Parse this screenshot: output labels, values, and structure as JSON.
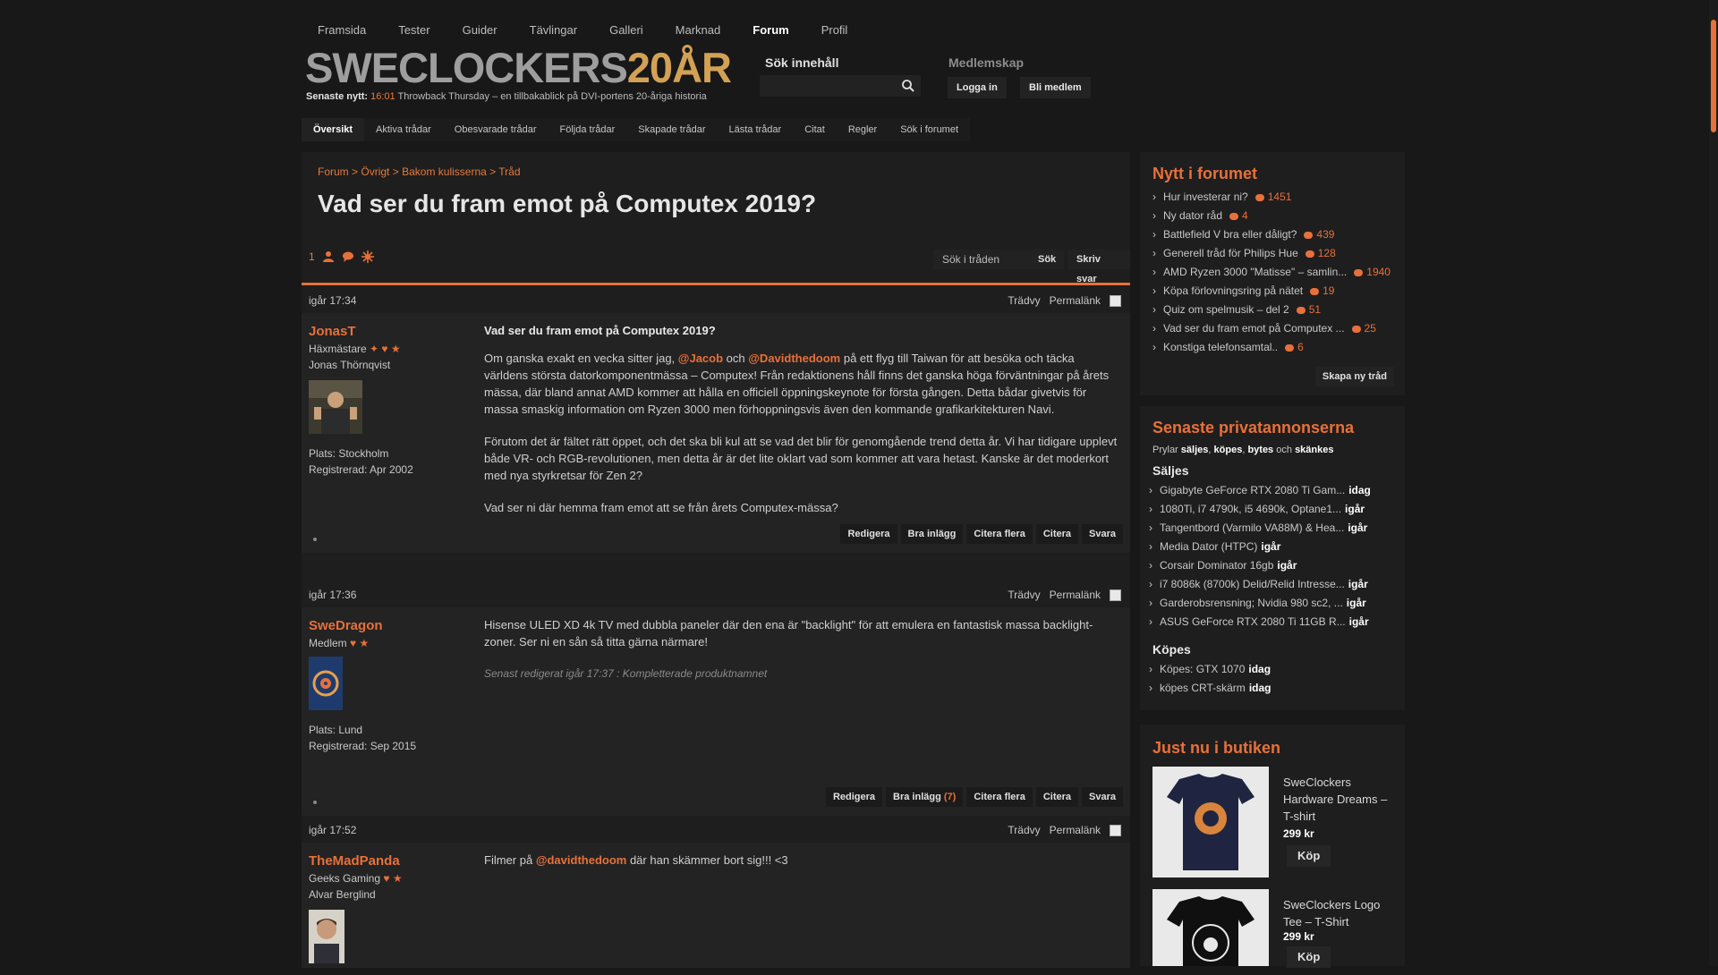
{
  "topnav": [
    "Framsida",
    "Tester",
    "Guider",
    "Tävlingar",
    "Galleri",
    "Marknad",
    "Forum",
    "Profil"
  ],
  "logo": {
    "part1": "SWECLOCKERS",
    "part2": "20ÅR"
  },
  "latest": {
    "label": "Senaste nytt:",
    "time": "16:01",
    "text": "Throwback Thursday – en tillbakablick på DVI-portens 20-åriga historia"
  },
  "search": {
    "title": "Sök innehåll",
    "placeholder": ""
  },
  "membership": {
    "title": "Medlemskap",
    "login": "Logga in",
    "register": "Bli medlem"
  },
  "subnav": [
    "Översikt",
    "Aktiva trådar",
    "Obesvarade trådar",
    "Följda trådar",
    "Skapade trådar",
    "Lästa trådar",
    "Citat",
    "Regler",
    "Sök i forumet"
  ],
  "breadcrumb": [
    "Forum",
    "Övrigt",
    "Bakom kulisserna",
    "Tråd"
  ],
  "thread": {
    "title": "Vad ser du fram emot på Computex 2019?",
    "page": "1",
    "search_placeholder": "Sök i tråden",
    "search_btn": "Sök",
    "reply_btn": "Skriv svar"
  },
  "post_links": {
    "tree": "Trädvy",
    "perma": "Permalänk"
  },
  "actions": {
    "edit": "Redigera",
    "good": "Bra inlägg",
    "quote_more": "Citera flera",
    "quote": "Citera",
    "reply": "Svara"
  },
  "posts": [
    {
      "time": "igår 17:34",
      "name": "JonasT",
      "rank": "Häxmästare",
      "realname": "Jonas Thörnqvist",
      "place": "Plats: Stockholm",
      "registered": "Registrerad: Apr 2002",
      "subject": "Vad ser du fram emot på Computex 2019?",
      "p1a": "Om ganska exakt en vecka sitter jag,",
      "m1": "@Jacob",
      "p1b": "och",
      "m2": "@Davidthedoom",
      "p1c": "på ett flyg till Taiwan för att besöka och täcka världens största datorkomponentmässa – Computex! Från redaktionens håll finns det ganska höga förväntningar på årets mässa, där bland annat AMD kommer att hålla en officiell öppningskeynote för första gången. Detta bådar givetvis för massa smaskig information om Ryzen 3000 men förhoppningsvis även den kommande grafikarkitekturen Navi.",
      "p2": "Förutom det är fältet rätt öppet, och det ska bli kul att se vad det blir för genomgående trend detta år. Vi har tidigare upplevt både VR- och RGB-revolutionen, men detta år är det lite oklart vad som kommer att vara hetast. Kanske är det moderkort med nya styrkretsar för Zen 2?",
      "p3": "Vad ser ni där hemma fram emot att se från årets Computex-mässa?"
    },
    {
      "time": "igår 17:36",
      "name": "SweDragon",
      "rank": "Medlem",
      "place": "Plats: Lund",
      "registered": "Registrerad: Sep 2015",
      "p1": "Hisense ULED XD 4k TV med dubbla paneler där den ena är \"backlight\" för att emulera en fantastisk massa backlight-zoner. Ser ni en sån så titta gärna närmare!",
      "edited": "Senast redigerat igår 17:37 : Kompletterade produktnamnet",
      "good_count": "(7)"
    },
    {
      "time": "igår 17:52",
      "name": "TheMadPanda",
      "rank": "Geeks Gaming",
      "realname": "Alvar Berglind",
      "p1a": "Filmer på",
      "m1": "@davidthedoom",
      "p1b": "där han skämmer bort sig!!! <3"
    }
  ],
  "side_forum": {
    "title": "Nytt i forumet",
    "items": [
      {
        "t": "Hur investerar ni?",
        "c": "1451"
      },
      {
        "t": "Ny dator råd",
        "c": "4"
      },
      {
        "t": "Battlefield V bra eller dåligt?",
        "c": "439"
      },
      {
        "t": "Generell tråd för Philips Hue",
        "c": "128"
      },
      {
        "t": "AMD Ryzen 3000 \"Matisse\" – samlin...",
        "c": "1940"
      },
      {
        "t": "Köpa förlovningsring på nätet",
        "c": "19"
      },
      {
        "t": "Quiz om spelmusik – del 2",
        "c": "51"
      },
      {
        "t": "Vad ser du fram emot på Computex ...",
        "c": "25"
      },
      {
        "t": "Konstiga telefonsamtal..",
        "c": "6"
      }
    ],
    "new_thread": "Skapa ny tråd"
  },
  "side_ads": {
    "title": "Senaste privatannonserna",
    "sub_a": "Prylar",
    "sub_b": "säljes",
    "sub_c": "köpes",
    "sub_d": "bytes",
    "sub_e": "och",
    "sub_f": "skänkes",
    "sell_title": "Säljes",
    "sell": [
      {
        "t": "Gigabyte GeForce RTX 2080 Ti Gam...",
        "w": "idag"
      },
      {
        "t": "1080Ti, i7 4790k, i5 4690k, Optane1...",
        "w": "igår"
      },
      {
        "t": "Tangentbord (Varmilo VA88M) & Hea...",
        "w": "igår"
      },
      {
        "t": "Media Dator (HTPC)",
        "w": "igår"
      },
      {
        "t": "Corsair Dominator 16gb",
        "w": "igår"
      },
      {
        "t": "i7 8086k (8700k) Delid/Relid Intresse...",
        "w": "igår"
      },
      {
        "t": "Garderobsrensning; Nvidia 980 sc2, ...",
        "w": "igår"
      },
      {
        "t": "ASUS GeForce RTX 2080 Ti 11GB R...",
        "w": "igår"
      }
    ],
    "buy_title": "Köpes",
    "buy": [
      {
        "t": "Köpes: GTX 1070",
        "w": "idag"
      },
      {
        "t": "köpes CRT-skärm",
        "w": "idag"
      }
    ]
  },
  "side_shop": {
    "title": "Just nu i butiken",
    "products": [
      {
        "name": "SweClockers Hardware Dreams – T-shirt",
        "price": "299 kr",
        "buy": "Köp"
      },
      {
        "name": "SweClockers Logo Tee – T-Shirt",
        "price": "299 kr",
        "buy": "Köp"
      }
    ]
  },
  "colors": {
    "accent": "#e8703a",
    "bg": "#181818",
    "panel": "#1e1e1e"
  }
}
